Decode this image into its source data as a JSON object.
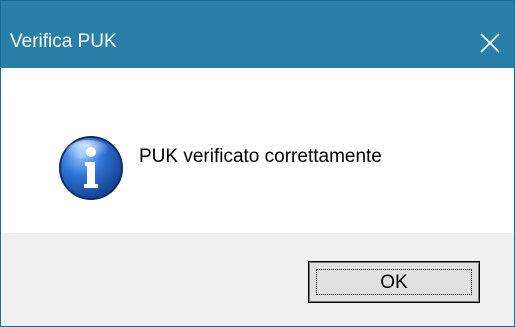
{
  "window": {
    "title": "Verifica PUK",
    "close_icon": "close-icon"
  },
  "dialog": {
    "icon": "info-icon",
    "message": "PUK verificato correttamente",
    "ok_label": "OK"
  },
  "colors": {
    "titlebar": "#2a7fa8",
    "footer": "#f0f0f0",
    "info_icon_blue": "#1f5fbf"
  }
}
